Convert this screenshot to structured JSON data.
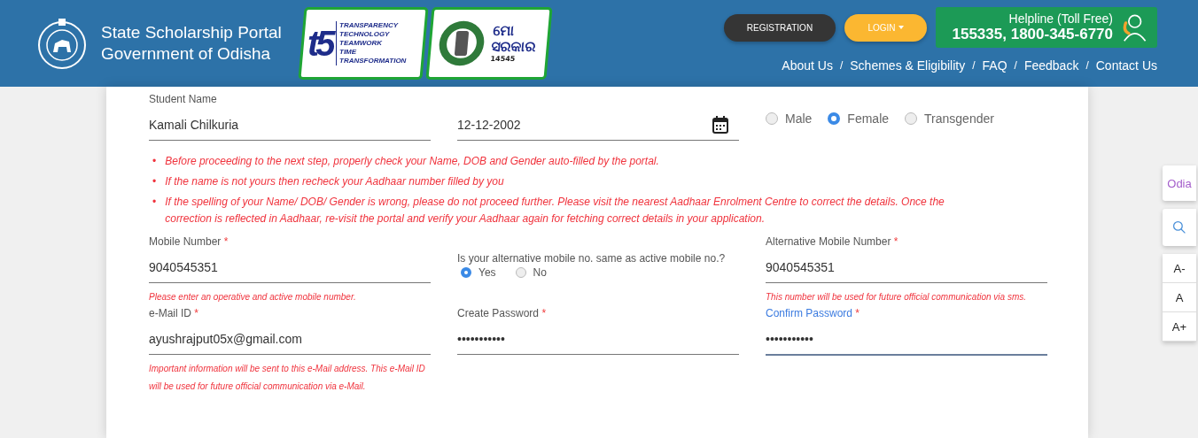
{
  "header": {
    "title_lines": [
      "State Scholarship Portal",
      "Government of Odisha"
    ],
    "t5_logo": {
      "mark": "t5",
      "words": [
        "TRANSPARENCY",
        "TECHNOLOGY",
        "TEAMWORK",
        "TIME",
        "TRANSFORMATION"
      ]
    },
    "mo_sarkar_logo": {
      "title_lines": [
        "ମୋ",
        "ସରକାର"
      ],
      "number": "14545"
    },
    "buttons": [
      {
        "label": "REGISTRATION",
        "kind": "dark"
      },
      {
        "label": "LOGIN",
        "kind": "dropdown"
      }
    ],
    "helpline": {
      "title": "Helpline (Toll Free)",
      "numbers": "155335, 1800-345-6770"
    },
    "nav": [
      {
        "label": "About Us"
      },
      {
        "label": "Schemes & Eligibility",
        "separator": "/"
      },
      {
        "label": "FAQ",
        "separator": "/"
      },
      {
        "label": "Feedback",
        "separator": "/"
      },
      {
        "label": "Contact Us",
        "separator": "/"
      }
    ]
  },
  "form": {
    "rows": [
      {
        "kind": "fields",
        "fields": [
          {
            "kind": "text",
            "label": "Student Name",
            "value": "Kamali Chilkuria",
            "focused": false
          },
          {
            "kind": "date",
            "value": "12-12-2002",
            "focused": false
          },
          {
            "kind": "radio",
            "options": [
              {
                "label": "Male",
                "selected": false
              },
              {
                "label": "Female",
                "selected": true
              },
              {
                "label": "Transgender",
                "selected": false
              }
            ]
          }
        ]
      },
      {
        "kind": "notes",
        "notes": [
          {
            "marker": "•",
            "text": "Before proceeding to the next step, properly check your Name, DOB and Gender auto-filled by the portal."
          },
          {
            "marker": "•",
            "text": "If the name is not yours then recheck your Aadhaar number filled by you"
          },
          {
            "marker": "•",
            "text": "If the spelling of your Name/ DOB/ Gender is wrong, please do not proceed further. Please visit the nearest Aadhaar Enrolment Centre to correct the details. Once the correction is reflected in Aadhaar, re-visit the portal and verify your Aadhaar again for fetching correct details in your application."
          }
        ]
      },
      {
        "kind": "fields",
        "fields": [
          {
            "kind": "text",
            "label": "Mobile Number",
            "required_mark": "*",
            "value": "9040545351",
            "hint": "Please enter an operative and active mobile number.",
            "focused": false
          },
          {
            "kind": "question",
            "question": "Is your alternative mobile no. same as active mobile no.?",
            "options": [
              {
                "label": "Yes",
                "selected": true
              },
              {
                "label": "No",
                "selected": false
              }
            ]
          },
          {
            "kind": "text",
            "label": "Alternative Mobile Number",
            "required_mark": "*",
            "value": "9040545351",
            "hint": "This number will be used for future official communication via sms.",
            "focused": false
          }
        ]
      },
      {
        "kind": "fields",
        "fields": [
          {
            "kind": "text",
            "label": "e-Mail ID",
            "required_mark": "*",
            "value": "ayushrajput05x@gmail.com",
            "hint": "Important information will be sent to this e-Mail address. This e-Mail ID will be used for future official communication via e-Mail.",
            "focused": false
          },
          {
            "kind": "text",
            "label": "Create Password",
            "required_mark": "*",
            "value": "•••••••••••",
            "focused": false
          },
          {
            "kind": "text",
            "label": "Confirm Password",
            "required_mark": "*",
            "value": "•••••••••••",
            "focused": true
          }
        ]
      }
    ]
  },
  "side_tools": {
    "language": "Odia",
    "font_sizes": [
      "A-",
      "A",
      "A+"
    ]
  }
}
